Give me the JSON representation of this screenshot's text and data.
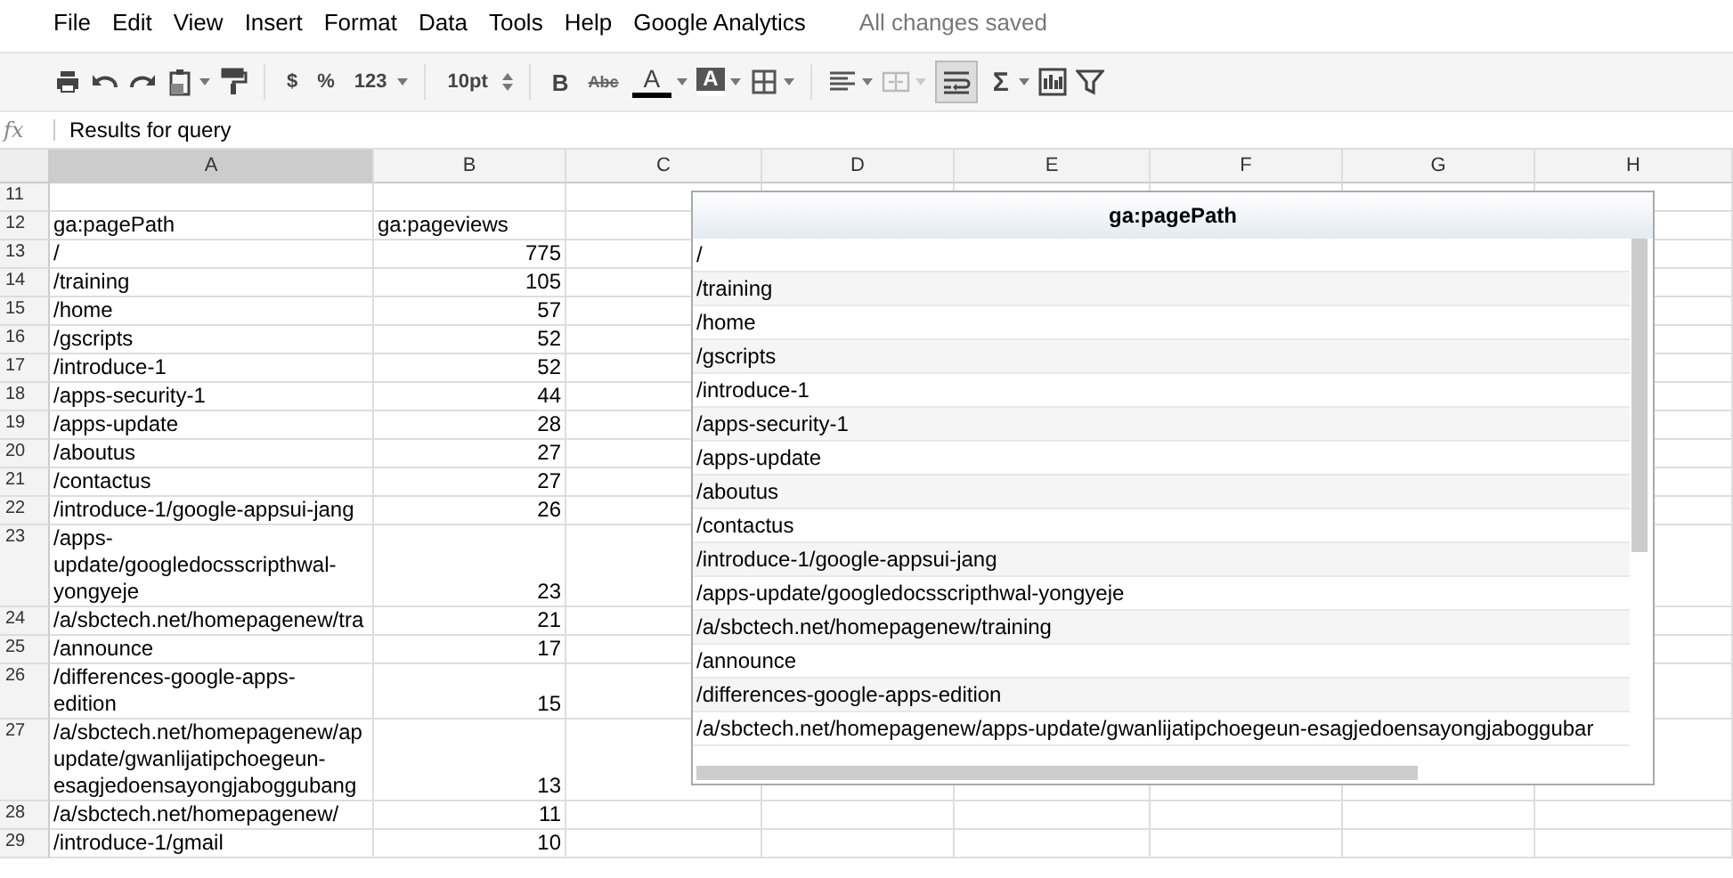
{
  "menu": [
    {
      "label": "File"
    },
    {
      "label": "Edit"
    },
    {
      "label": "View"
    },
    {
      "label": "Insert"
    },
    {
      "label": "Format"
    },
    {
      "label": "Data"
    },
    {
      "label": "Tools"
    },
    {
      "label": "Help"
    },
    {
      "label": "Google Analytics"
    }
  ],
  "save_status": "All changes saved",
  "toolbar": {
    "currency": "$",
    "percent": "%",
    "number_format": "123",
    "font_size": "10pt",
    "bold": "B",
    "strikethrough": "Abc",
    "text_color": "A",
    "fill_color": "A",
    "sum": "Σ",
    "wrap_text_on": true
  },
  "formula_bar": {
    "label": "fx",
    "value": "Results for query"
  },
  "columns": [
    {
      "label": "A",
      "selected": true
    },
    {
      "label": "B",
      "selected": false
    },
    {
      "label": "C",
      "selected": false
    },
    {
      "label": "D",
      "selected": false
    },
    {
      "label": "E",
      "selected": false
    },
    {
      "label": "F",
      "selected": false
    },
    {
      "label": "G",
      "selected": false
    },
    {
      "label": "H",
      "selected": false
    }
  ],
  "rows": [
    {
      "number": "11",
      "a": [],
      "b": "",
      "kind": "header"
    },
    {
      "number": "12",
      "a": [
        "ga:pagePath"
      ],
      "b": "ga:pageviews",
      "kind": "header"
    },
    {
      "number": "13",
      "a": [
        "/"
      ],
      "b": "775"
    },
    {
      "number": "14",
      "a": [
        "/training"
      ],
      "b": "105"
    },
    {
      "number": "15",
      "a": [
        "/home"
      ],
      "b": "57"
    },
    {
      "number": "16",
      "a": [
        "/gscripts"
      ],
      "b": "52"
    },
    {
      "number": "17",
      "a": [
        "/introduce-1"
      ],
      "b": "52"
    },
    {
      "number": "18",
      "a": [
        "/apps-security-1"
      ],
      "b": "44"
    },
    {
      "number": "19",
      "a": [
        "/apps-update"
      ],
      "b": "28"
    },
    {
      "number": "20",
      "a": [
        "/aboutus"
      ],
      "b": "27"
    },
    {
      "number": "21",
      "a": [
        "/contactus"
      ],
      "b": "27"
    },
    {
      "number": "22",
      "a": [
        "/introduce-1/google-appsui-jang"
      ],
      "b": "26"
    },
    {
      "number": "23",
      "a": [
        "/apps-",
        "update/googledocsscripthwal-",
        "yongyeje"
      ],
      "b": "23"
    },
    {
      "number": "24",
      "a": [
        "/a/sbctech.net/homepagenew/tra"
      ],
      "b": "21"
    },
    {
      "number": "25",
      "a": [
        "/announce"
      ],
      "b": "17"
    },
    {
      "number": "26",
      "a": [
        "/differences-google-apps-",
        "edition"
      ],
      "b": "15"
    },
    {
      "number": "27",
      "a": [
        "/a/sbctech.net/homepagenew/ap",
        "update/gwanlijatipchoegeun-",
        "esagjedoensayongjaboggubang"
      ],
      "b": "13"
    },
    {
      "number": "28",
      "a": [
        "/a/sbctech.net/homepagenew/"
      ],
      "b": "11"
    },
    {
      "number": "29",
      "a": [
        "/introduce-1/gmail"
      ],
      "b": "10"
    }
  ],
  "table_chart": {
    "header": "ga:pagePath",
    "rows": [
      "/",
      "/training",
      "/home",
      "/gscripts",
      "/introduce-1",
      "/apps-security-1",
      "/apps-update",
      "/aboutus",
      "/contactus",
      "/introduce-1/google-appsui-jang",
      "/apps-update/googledocsscripthwal-yongyeje",
      "/a/sbctech.net/homepagenew/training",
      "/announce",
      "/differences-google-apps-edition",
      "/a/sbctech.net/homepagenew/apps-update/gwanlijatipchoegeun-esagjedoensayongjaboggubar"
    ]
  }
}
